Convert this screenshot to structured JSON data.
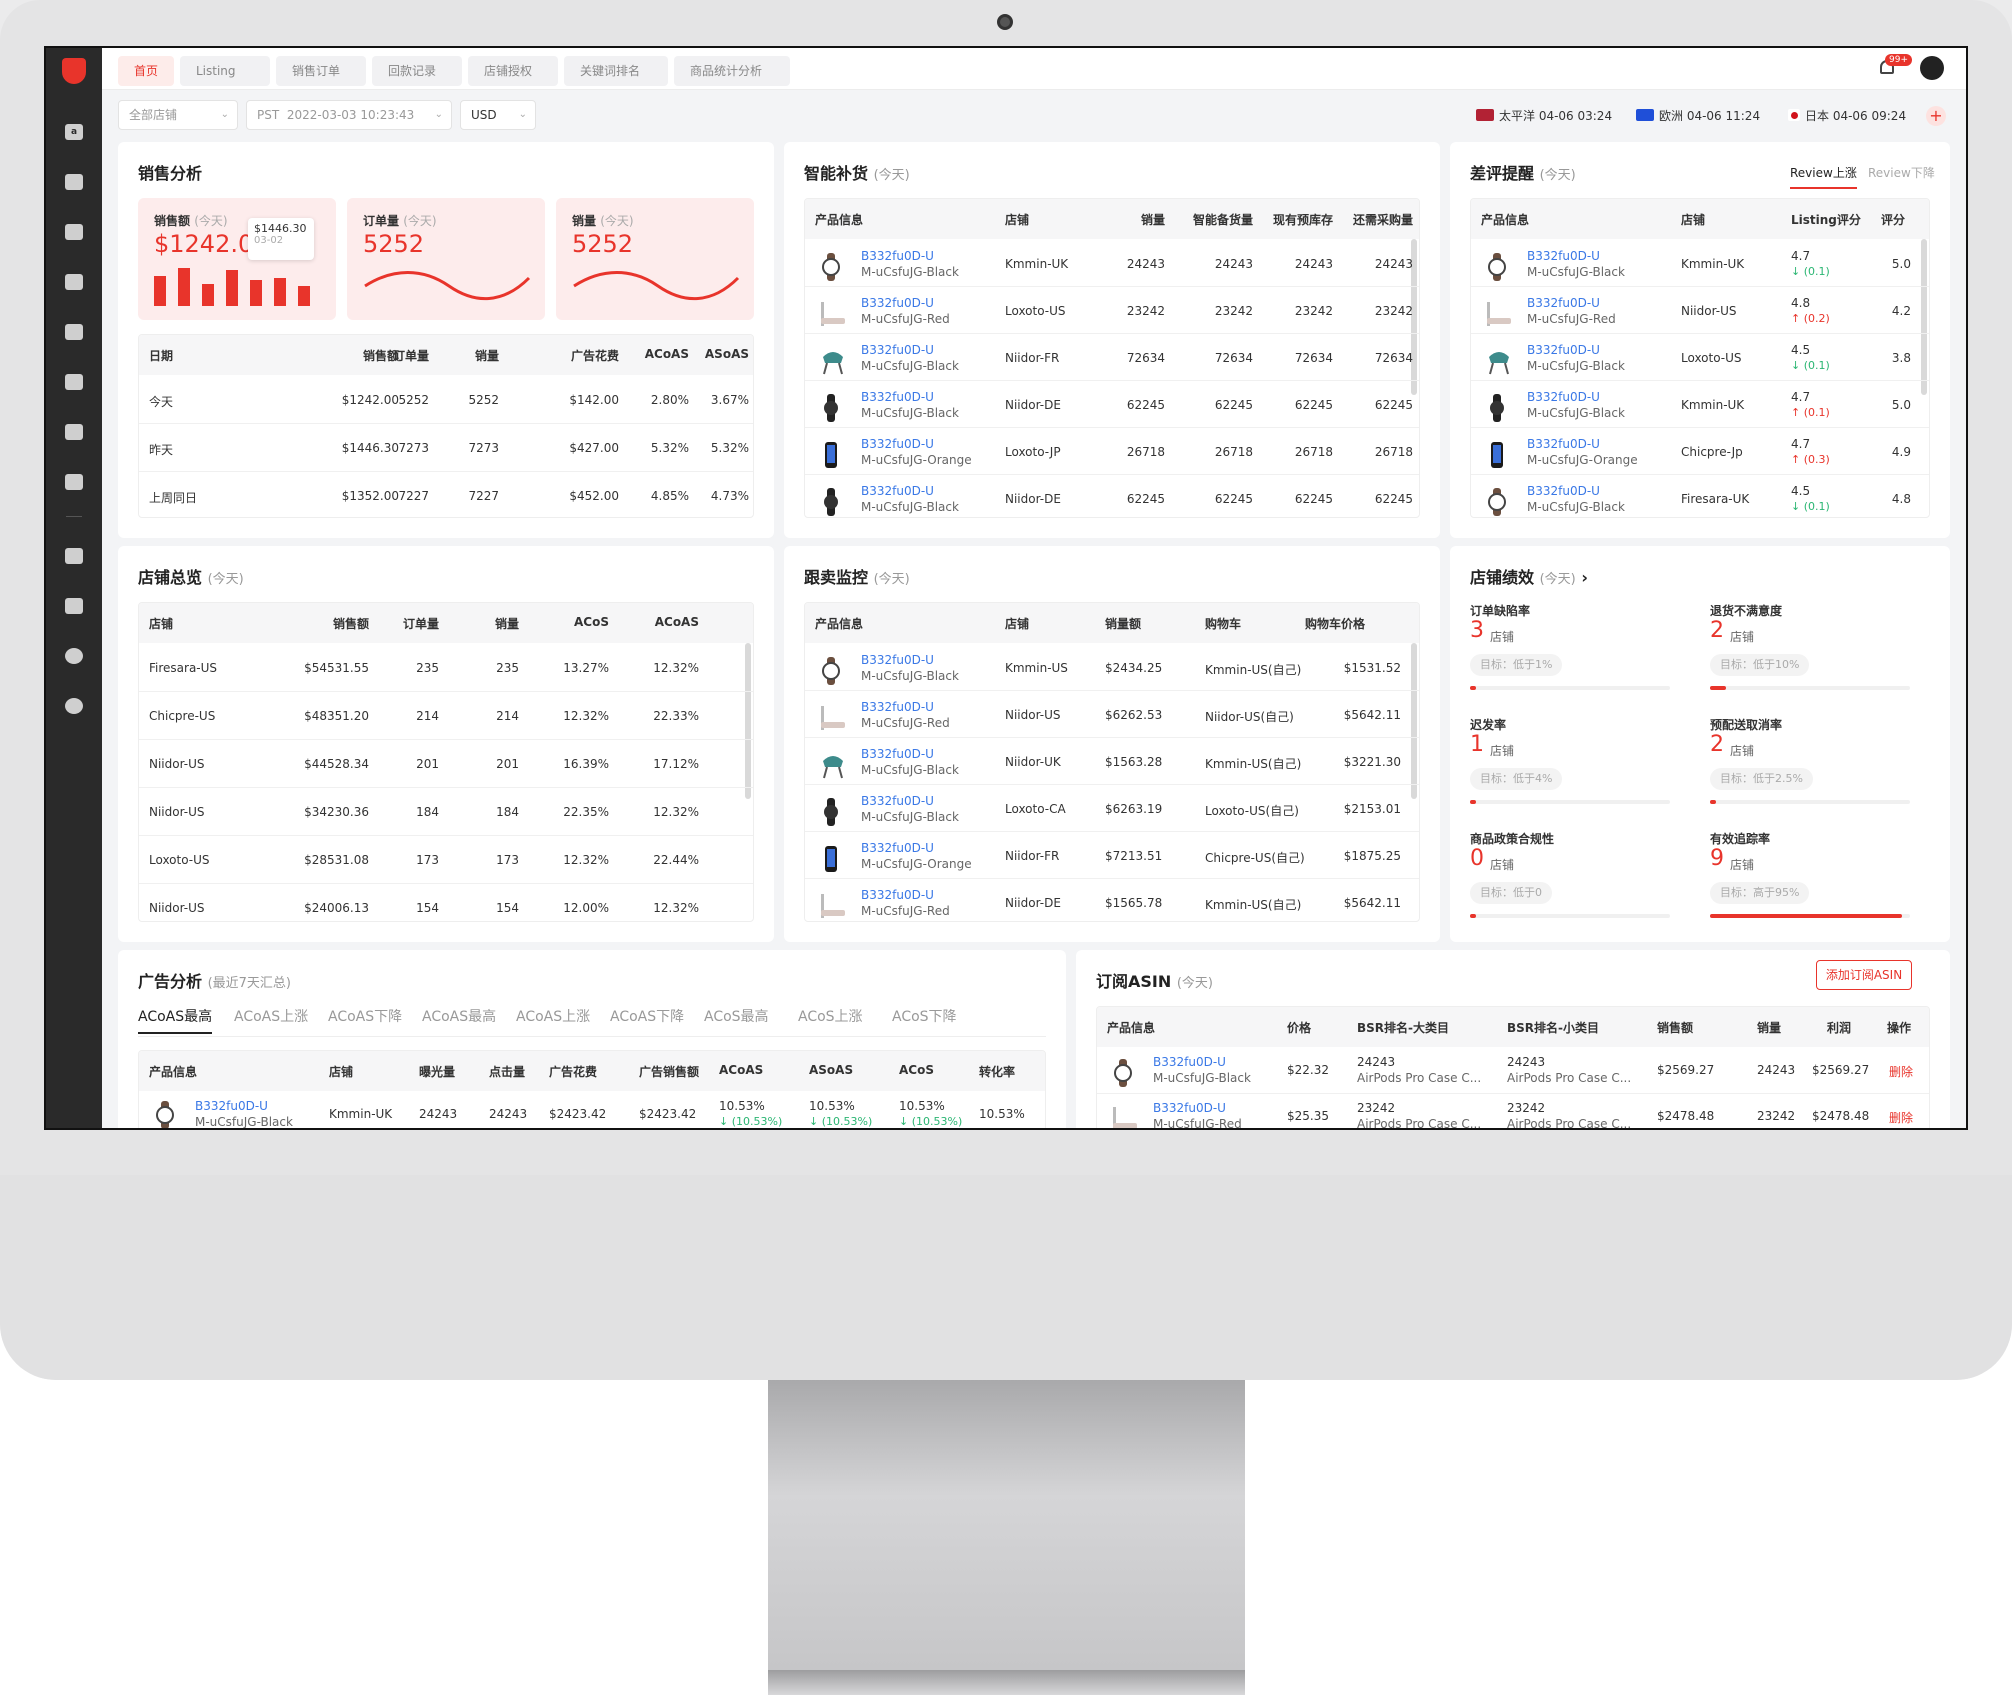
{
  "top_tabs": [
    "首页",
    "Listing",
    "销售订单",
    "回款记录",
    "店铺授权",
    "关键词排名",
    "商品统计分析"
  ],
  "badge": "99+",
  "filters": {
    "store": "全部店铺",
    "timezone": "PST",
    "datetime": "2022-03-03 10:23:43",
    "currency": "USD"
  },
  "clocks": [
    {
      "label": "太平洋 04-06 03:24",
      "color": "#b22234"
    },
    {
      "label": "欧洲 04-06 11:24",
      "color": "#1f4fd8"
    },
    {
      "label": "日本 04-06 09:24",
      "color": "#d1141c"
    }
  ],
  "sales": {
    "title": "销售分析",
    "kpis": [
      {
        "label": "销售额",
        "sub": "(今天)",
        "value": "$1242.00"
      },
      {
        "label": "订单量",
        "sub": "(今天)",
        "value": "5252"
      },
      {
        "label": "销量",
        "sub": "(今天)",
        "value": "5252"
      }
    ],
    "tooltip": {
      "value": "$1446.30",
      "date": "03-02"
    },
    "headers": [
      "日期",
      "销售额",
      "订单量",
      "销量",
      "广告花费",
      "ACoAS",
      "ASoAS"
    ],
    "rows": [
      [
        "今天",
        "$1242.00",
        "5252",
        "5252",
        "$142.00",
        "2.80%",
        "3.67%"
      ],
      [
        "昨天",
        "$1446.30",
        "7273",
        "7273",
        "$427.00",
        "5.32%",
        "5.32%"
      ],
      [
        "上周同日",
        "$1352.00",
        "7227",
        "7227",
        "$452.00",
        "4.85%",
        "4.73%"
      ]
    ]
  },
  "replenish": {
    "title": "智能补货",
    "sub": "(今天)",
    "headers": [
      "产品信息",
      "店铺",
      "销量",
      "智能备货量",
      "现有预库存",
      "还需采购量"
    ],
    "rows": [
      {
        "asin": "B332fu0D-U",
        "sku": "M-uCsfuJG-Black",
        "store": "Kmmin-UK",
        "v": [
          "24243",
          "24243",
          "24243",
          "24243"
        ],
        "thumb": "watch"
      },
      {
        "asin": "B332fu0D-U",
        "sku": "M-uCsfuJG-Red",
        "store": "Loxoto-US",
        "v": [
          "23242",
          "23242",
          "23242",
          "23242"
        ],
        "thumb": "bed"
      },
      {
        "asin": "B332fu0D-U",
        "sku": "M-uCsfuJG-Black",
        "store": "Niidor-FR",
        "v": [
          "72634",
          "72634",
          "72634",
          "72634"
        ],
        "thumb": "chair"
      },
      {
        "asin": "B332fu0D-U",
        "sku": "M-uCsfuJG-Black",
        "store": "Niidor-DE",
        "v": [
          "62245",
          "62245",
          "62245",
          "62245"
        ],
        "thumb": "watch2"
      },
      {
        "asin": "B332fu0D-U",
        "sku": "M-uCsfuJG-Orange",
        "store": "Loxoto-JP",
        "v": [
          "26718",
          "26718",
          "26718",
          "26718"
        ],
        "thumb": "phone"
      },
      {
        "asin": "B332fu0D-U",
        "sku": "M-uCsfuJG-Black",
        "store": "Niidor-DE",
        "v": [
          "62245",
          "62245",
          "62245",
          "62245"
        ],
        "thumb": "watch2"
      }
    ]
  },
  "reviews": {
    "title": "差评提醒",
    "sub": "(今天)",
    "tab_up": "Review上涨",
    "tab_down": "Review下降",
    "headers": [
      "产品信息",
      "店铺",
      "Listing评分",
      "评分"
    ],
    "rows": [
      {
        "asin": "B332fu0D-U",
        "sku": "M-uCsfuJG-Black",
        "store": "Kmmin-UK",
        "listing": "4.7",
        "delta": "↓ (0.1)",
        "dir": "down",
        "score": "5.0",
        "thumb": "watch"
      },
      {
        "asin": "B332fu0D-U",
        "sku": "M-uCsfuJG-Red",
        "store": "Niidor-US",
        "listing": "4.8",
        "delta": "↑ (0.2)",
        "dir": "up",
        "score": "4.2",
        "thumb": "bed"
      },
      {
        "asin": "B332fu0D-U",
        "sku": "M-uCsfuJG-Black",
        "store": "Loxoto-US",
        "listing": "4.5",
        "delta": "↓ (0.1)",
        "dir": "down",
        "score": "3.8",
        "thumb": "chair"
      },
      {
        "asin": "B332fu0D-U",
        "sku": "M-uCsfuJG-Black",
        "store": "Kmmin-UK",
        "listing": "4.7",
        "delta": "↑ (0.1)",
        "dir": "up",
        "score": "5.0",
        "thumb": "watch2"
      },
      {
        "asin": "B332fu0D-U",
        "sku": "M-uCsfuJG-Orange",
        "store": "Chicpre-Jp",
        "listing": "4.7",
        "delta": "↑ (0.3)",
        "dir": "up",
        "score": "4.9",
        "thumb": "phone"
      },
      {
        "asin": "B332fu0D-U",
        "sku": "M-uCsfuJG-Black",
        "store": "Firesara-UK",
        "listing": "4.5",
        "delta": "↓ (0.1)",
        "dir": "down",
        "score": "4.8",
        "thumb": "watch"
      }
    ]
  },
  "stores": {
    "title": "店铺总览",
    "sub": "(今天)",
    "headers": [
      "店铺",
      "销售额",
      "订单量",
      "销量",
      "ACoS",
      "ACoAS"
    ],
    "rows": [
      [
        "Firesara-US",
        "$54531.55",
        "235",
        "235",
        "13.27%",
        "12.32%"
      ],
      [
        "Chicpre-US",
        "$48351.20",
        "214",
        "214",
        "12.32%",
        "22.33%"
      ],
      [
        "Niidor-US",
        "$44528.34",
        "201",
        "201",
        "16.39%",
        "17.12%"
      ],
      [
        "Niidor-US",
        "$34230.36",
        "184",
        "184",
        "22.35%",
        "12.32%"
      ],
      [
        "Loxoto-US",
        "$28531.08",
        "173",
        "173",
        "12.32%",
        "22.44%"
      ],
      [
        "Niidor-US",
        "$24006.13",
        "154",
        "154",
        "12.00%",
        "12.32%"
      ]
    ]
  },
  "follow": {
    "title": "跟卖监控",
    "sub": "(今天)",
    "headers": [
      "产品信息",
      "店铺",
      "销量额",
      "购物车",
      "购物车价格"
    ],
    "rows": [
      {
        "asin": "B332fu0D-U",
        "sku": "M-uCsfuJG-Black",
        "store": "Kmmin-US",
        "amount": "$2434.25",
        "cart": "Kmmin-US(自己)",
        "price": "$1531.52",
        "thumb": "watch"
      },
      {
        "asin": "B332fu0D-U",
        "sku": "M-uCsfuJG-Red",
        "store": "Niidor-US",
        "amount": "$6262.53",
        "cart": "Niidor-US(自己)",
        "price": "$5642.11",
        "thumb": "bed"
      },
      {
        "asin": "B332fu0D-U",
        "sku": "M-uCsfuJG-Black",
        "store": "Niidor-UK",
        "amount": "$1563.28",
        "cart": "Kmmin-US(自己)",
        "price": "$3221.30",
        "thumb": "chair"
      },
      {
        "asin": "B332fu0D-U",
        "sku": "M-uCsfuJG-Black",
        "store": "Loxoto-CA",
        "amount": "$6263.19",
        "cart": "Loxoto-US(自己)",
        "price": "$2153.01",
        "thumb": "watch2"
      },
      {
        "asin": "B332fu0D-U",
        "sku": "M-uCsfuJG-Orange",
        "store": "Niidor-FR",
        "amount": "$7213.51",
        "cart": "Chicpre-US(自己)",
        "price": "$1875.25",
        "thumb": "phone"
      },
      {
        "asin": "B332fu0D-U",
        "sku": "M-uCsfuJG-Red",
        "store": "Niidor-DE",
        "amount": "$1565.78",
        "cart": "Kmmin-US(自己)",
        "price": "$5642.11",
        "thumb": "bed"
      }
    ]
  },
  "performance": {
    "title": "店铺绩效",
    "sub": "(今天)",
    "unit": "店铺",
    "items": [
      {
        "label": "订单缺陷率",
        "value": "3",
        "target": "目标：低于1%",
        "fill": 0.03
      },
      {
        "label": "退货不满意度",
        "value": "2",
        "target": "目标：低于10%",
        "fill": 0.08
      },
      {
        "label": "迟发率",
        "value": "1",
        "target": "目标：低于4%",
        "fill": 0.03
      },
      {
        "label": "预配送取消率",
        "value": "2",
        "target": "目标：低于2.5%",
        "fill": 0.03
      },
      {
        "label": "商品政策合规性",
        "value": "0",
        "target": "目标：低于0",
        "fill": 0.03
      },
      {
        "label": "有效追踪率",
        "value": "9",
        "target": "目标：高于95%",
        "fill": 0.96
      }
    ]
  },
  "ads": {
    "title": "广告分析",
    "sub": "(最近7天汇总)",
    "tabs": [
      "ACoAS最高",
      "ACoAS上涨",
      "ACoAS下降",
      "ACoAS最高",
      "ACoAS上涨",
      "ACoAS下降",
      "ACoS最高",
      "ACoS上涨",
      "ACoS下降"
    ],
    "headers": [
      "产品信息",
      "店铺",
      "曝光量",
      "点击量",
      "广告花费",
      "广告销售额",
      "ACoAS",
      "ASoAS",
      "ACoS",
      "转化率"
    ],
    "row": {
      "asin": "B332fu0D-U",
      "sku": "M-uCsfuJG-Black",
      "store": "Kmmin-UK",
      "impr": "24243",
      "clicks": "24243",
      "spend": "$2423.42",
      "sales": "$2423.42",
      "acoas": "10.53%",
      "acoas_d": "↓ (10.53%)",
      "asoas": "10.53%",
      "asoas_d": "↓ (10.53%)",
      "acos": "10.53%",
      "acos_d": "↓ (10.53%)",
      "cvr": "10.53%"
    }
  },
  "subscribe": {
    "title": "订阅ASIN",
    "sub": "(今天)",
    "add_button": "添加订阅ASIN",
    "headers": [
      "产品信息",
      "价格",
      "BSR排名-大类目",
      "BSR排名-小类目",
      "销售额",
      "销量",
      "利润",
      "操作"
    ],
    "rows": [
      {
        "asin": "B332fu0D-U",
        "sku": "M-uCsfuJG-Black",
        "price": "$22.32",
        "bsr1": "24243",
        "bsr1c": "AirPods Pro Case C...",
        "bsr2": "24243",
        "bsr2c": "AirPods Pro Case C...",
        "sales": "$2569.27",
        "qty": "24243",
        "profit": "$2569.27",
        "op": "删除",
        "thumb": "watch"
      },
      {
        "asin": "B332fu0D-U",
        "sku": "M-uCsfuJG-Red",
        "price": "$25.35",
        "bsr1": "23242",
        "bsr1c": "AirPods Pro Case C...",
        "bsr2": "23242",
        "bsr2c": "AirPods Pro Case C...",
        "sales": "$2478.48",
        "qty": "23242",
        "profit": "$2478.48",
        "op": "删除",
        "thumb": "bed"
      }
    ]
  }
}
